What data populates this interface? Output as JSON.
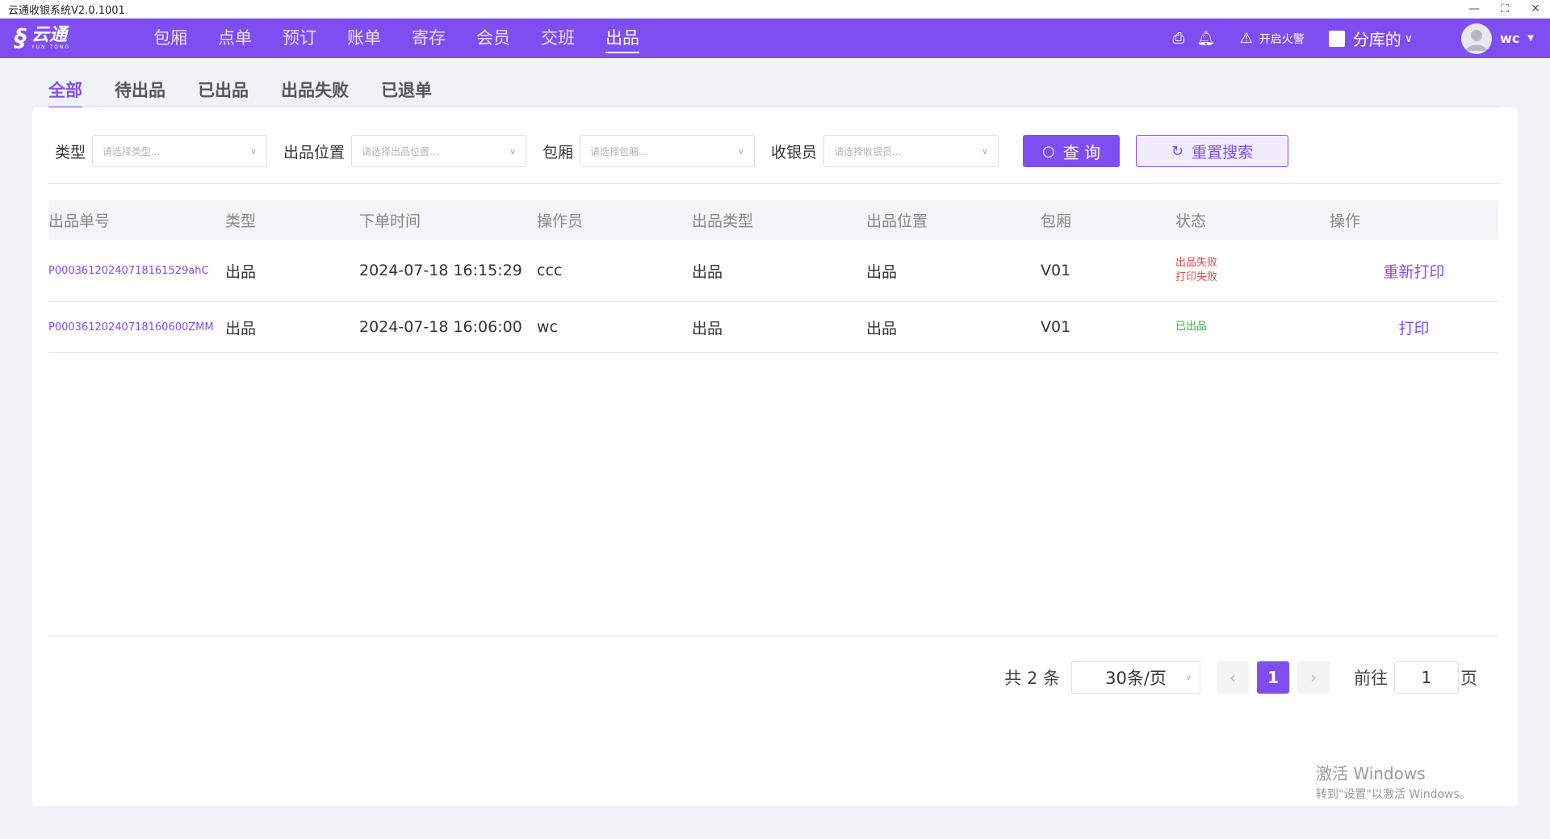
{
  "window": {
    "title": "云通收银系统V2.0.1001",
    "controls": [
      "—",
      "⛶",
      "✕"
    ]
  },
  "brand": {
    "name": "云通",
    "sub": "YUN TONG"
  },
  "nav": {
    "items": [
      {
        "label": "包厢"
      },
      {
        "label": "点单"
      },
      {
        "label": "预订"
      },
      {
        "label": "账单"
      },
      {
        "label": "寄存"
      },
      {
        "label": "会员"
      },
      {
        "label": "交班"
      },
      {
        "label": "出品"
      }
    ],
    "active": "出品",
    "alarm_label": "开启火警",
    "store_label": "分库的",
    "user_name": "wc"
  },
  "tabs": [
    {
      "label": "全部"
    },
    {
      "label": "待出品"
    },
    {
      "label": "已出品"
    },
    {
      "label": "出品失败"
    },
    {
      "label": "已退单"
    }
  ],
  "filters": {
    "type": {
      "label": "类型",
      "placeholder": "请选择类型..."
    },
    "location": {
      "label": "出品位置",
      "placeholder": "请选择出品位置..."
    },
    "room": {
      "label": "包厢",
      "placeholder": "请选择包厢..."
    },
    "cashier": {
      "label": "收银员",
      "placeholder": "请选择收银员..."
    },
    "query_label": "查 询",
    "reset_label": "重置搜索"
  },
  "table": {
    "columns": [
      "出品单号",
      "类型",
      "下单时间",
      "操作员",
      "出品类型",
      "出品位置",
      "包厢",
      "状态",
      "操作"
    ],
    "rows": [
      {
        "order_no": "P00036120240718161529ahC",
        "type": "出品",
        "time": "2024-07-18 16:15:29",
        "operator": "ccc",
        "product_type": "出品",
        "location": "出品",
        "room": "V01",
        "status": [
          "出品失败",
          "打印失败"
        ],
        "action": "重新打印"
      },
      {
        "order_no": "P0003612024071816060​0ZMM",
        "type": "出品",
        "time": "2024-07-18 16:06:00",
        "operator": "wc",
        "product_type": "出品",
        "location": "出品",
        "room": "V01",
        "status": [
          "已出品"
        ],
        "action": "打印"
      }
    ]
  },
  "pagination": {
    "total_text": "共 2 条",
    "page_size": "30条/页",
    "current_page": "1",
    "goto_label": "前往",
    "goto_value": "1",
    "page_suffix": "页"
  },
  "watermark": {
    "line1": "激活 Windows",
    "line2": "转到\"设置\"以激活 Windows。"
  },
  "colors": {
    "accent": "#7f4ef0",
    "fail": "#e8474a",
    "success": "#36b336"
  }
}
